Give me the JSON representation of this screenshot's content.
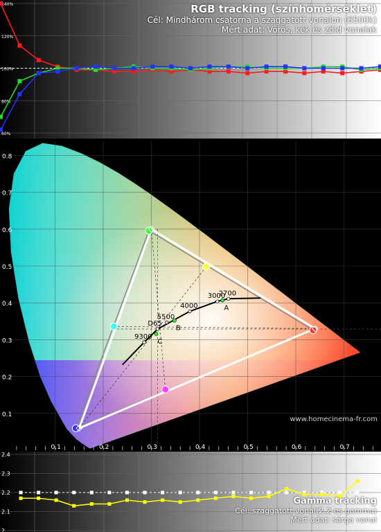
{
  "rgb_panel": {
    "title": "RGB tracking (színhőmérséklet)",
    "line1": "Cél: Mindhárom csatorna a szaggatott vonalon (6500k)",
    "line2": "Mért adat: Vörös, kék és zöld vonalak"
  },
  "gamma_panel": {
    "title": "Gamma tracking",
    "line1": "Cél: szaggatott vonal(2.2-es gamma)",
    "line2": "Mért adat: sárga vonal"
  },
  "watermark": "www.homecinema-fr.com",
  "colors": {
    "red": "#ff1a1a",
    "green": "#22dd22",
    "blue": "#2233ff",
    "yellow": "#ffff00",
    "target_triangle": "#ffffff",
    "planckian": "#000000"
  },
  "chart_data": [
    {
      "type": "line",
      "name": "rgb-tracking",
      "ytick_labels": [
        "140%",
        "120%",
        "100%",
        "80%",
        "60%"
      ],
      "ylim": [
        60,
        140
      ],
      "x": [
        0,
        1,
        2,
        3,
        4,
        5,
        6,
        7,
        8,
        9,
        10,
        11,
        12,
        13,
        14,
        15,
        16,
        17,
        18,
        19,
        20
      ],
      "target": 100,
      "series": [
        {
          "name": "red",
          "values": [
            140,
            114,
            105,
            101,
            99,
            99,
            98,
            98,
            99,
            98,
            99,
            98,
            98,
            97,
            98,
            98,
            97,
            98,
            97,
            98,
            99
          ]
        },
        {
          "name": "green",
          "values": [
            70,
            92,
            97,
            100,
            100,
            99,
            100,
            101,
            100,
            100,
            99,
            100,
            101,
            101,
            100,
            100,
            100,
            101,
            101,
            99,
            100
          ]
        },
        {
          "name": "blue",
          "values": [
            62,
            84,
            97,
            98,
            100,
            101,
            100,
            100,
            101,
            101,
            100,
            101,
            101,
            100,
            101,
            101,
            100,
            100,
            100,
            100,
            101
          ]
        }
      ]
    },
    {
      "type": "scatter",
      "name": "cie-chromaticity",
      "xlim": [
        0,
        0.8
      ],
      "ylim": [
        0,
        0.85
      ],
      "xtick_labels": [
        "0.1",
        "0.2",
        "0.3",
        "0.4",
        "0.5",
        "0.6",
        "0.7"
      ],
      "ytick_labels": [
        "0.1",
        "0.2",
        "0.3",
        "0.4",
        "0.5",
        "0.6",
        "0.7",
        "0.8"
      ],
      "target_gamut": [
        {
          "x": 0.64,
          "y": 0.33
        },
        {
          "x": 0.3,
          "y": 0.6
        },
        {
          "x": 0.15,
          "y": 0.06
        }
      ],
      "measured_gamut": [
        {
          "x": 0.636,
          "y": 0.326
        },
        {
          "x": 0.295,
          "y": 0.596
        },
        {
          "x": 0.143,
          "y": 0.06
        }
      ],
      "secondaries": [
        {
          "x": 0.414,
          "y": 0.498
        },
        {
          "x": 0.222,
          "y": 0.336
        },
        {
          "x": 0.329,
          "y": 0.165
        }
      ],
      "planckian_locus": [
        {
          "x": 0.24,
          "y": 0.232
        },
        {
          "x": 0.262,
          "y": 0.262
        },
        {
          "x": 0.285,
          "y": 0.293
        },
        {
          "x": 0.313,
          "y": 0.329
        },
        {
          "x": 0.345,
          "y": 0.352
        },
        {
          "x": 0.38,
          "y": 0.377
        },
        {
          "x": 0.437,
          "y": 0.404
        },
        {
          "x": 0.46,
          "y": 0.411
        },
        {
          "x": 0.527,
          "y": 0.413
        }
      ],
      "cct_labels": [
        {
          "label": "9300",
          "x": 0.285,
          "y": 0.293
        },
        {
          "label": "D65",
          "x": 0.3127,
          "y": 0.329
        },
        {
          "label": "5500",
          "x": 0.332,
          "y": 0.347
        },
        {
          "label": "4000",
          "x": 0.38,
          "y": 0.377
        },
        {
          "label": "3000",
          "x": 0.437,
          "y": 0.404
        },
        {
          "label": "2700",
          "x": 0.46,
          "y": 0.411
        }
      ],
      "illuminants": [
        {
          "label": "A",
          "x": 0.448,
          "y": 0.407
        },
        {
          "label": "B",
          "x": 0.348,
          "y": 0.352
        },
        {
          "label": "C",
          "x": 0.31,
          "y": 0.316
        }
      ],
      "white_point": {
        "x": 0.313,
        "y": 0.329
      }
    },
    {
      "type": "line",
      "name": "gamma-tracking",
      "ytick_labels": [
        "2.4",
        "2.3",
        "2.2",
        "2.1",
        "2"
      ],
      "ylim": [
        2.0,
        2.4
      ],
      "x": [
        0,
        1,
        2,
        3,
        4,
        5,
        6,
        7,
        8,
        9,
        10,
        11,
        12,
        13,
        14,
        15,
        16,
        17,
        18,
        19
      ],
      "target": 2.2,
      "series": [
        {
          "name": "gamma",
          "values": [
            2.17,
            2.17,
            2.16,
            2.13,
            2.14,
            2.14,
            2.16,
            2.15,
            2.16,
            2.15,
            2.16,
            2.17,
            2.18,
            2.17,
            2.18,
            2.22,
            2.19,
            2.19,
            2.18,
            2.26
          ]
        }
      ]
    }
  ]
}
